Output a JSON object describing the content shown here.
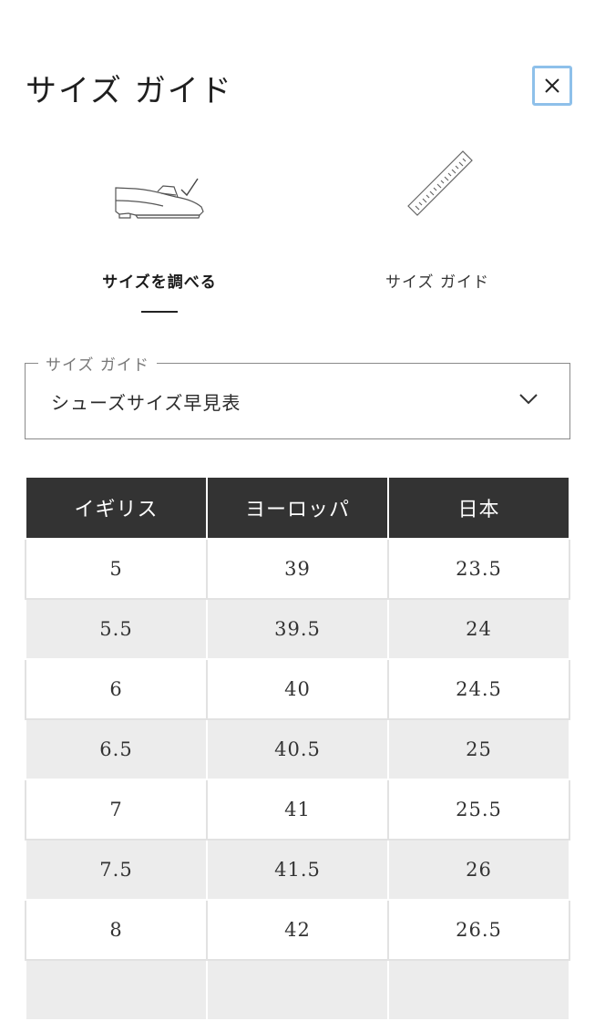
{
  "header": {
    "title": "サイズ ガイド",
    "close_icon": "close-icon"
  },
  "tabs": [
    {
      "label": "サイズを調べる",
      "icon": "loafer-shoe-icon",
      "active": true
    },
    {
      "label": "サイズ ガイド",
      "icon": "ruler-icon",
      "active": false
    }
  ],
  "guide_select": {
    "legend": "サイズ ガイド",
    "value": "シューズサイズ早見表",
    "icon": "chevron-down-icon"
  },
  "size_table": {
    "headers": [
      "イギリス",
      "ヨーロッパ",
      "日本"
    ],
    "rows": [
      [
        "5",
        "39",
        "23.5"
      ],
      [
        "5.5",
        "39.5",
        "24"
      ],
      [
        "6",
        "40",
        "24.5"
      ],
      [
        "6.5",
        "40.5",
        "25"
      ],
      [
        "7",
        "41",
        "25.5"
      ],
      [
        "7.5",
        "41.5",
        "26"
      ],
      [
        "8",
        "42",
        "26.5"
      ]
    ]
  },
  "colors": {
    "header_bg": "#333333",
    "stripe": "#ececec",
    "focus_ring": "#8ec0ea"
  }
}
